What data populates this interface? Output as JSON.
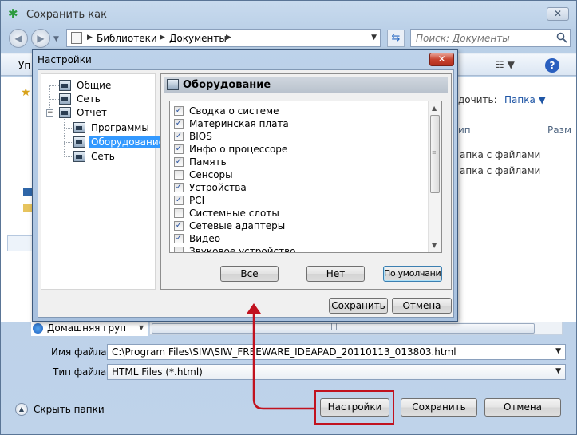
{
  "main": {
    "title": "Сохранить как",
    "close_glyph": "✕",
    "breadcrumbs": [
      "Библиотеки",
      "Документы"
    ],
    "search_placeholder": "Поиск: Документы",
    "toolbar_left": "Уп",
    "arrange_label": "дочить:",
    "arrange_value": "Папка",
    "columns": [
      "Тип",
      "Разм"
    ],
    "columns_visible": [
      "ип",
      "Разм"
    ],
    "file_rows": [
      "апка с файлами",
      "апка с файлами"
    ],
    "nav_home_group": "Домашняя груп",
    "filename_label": "Имя файла:",
    "filename_value": "C:\\Program Files\\SIW\\SIW_FREEWARE_IDEAPAD_20110113_013803.html",
    "filetype_label": "Тип файла:",
    "filetype_value": "HTML Files (*.html)",
    "hide_folders_label": "Скрыть папки",
    "buttons": {
      "settings": "Настройки",
      "save": "Сохранить",
      "cancel": "Отмена"
    }
  },
  "settings_dialog": {
    "title": "Настройки",
    "close_glyph": "✕",
    "tree": [
      {
        "label": "Общие"
      },
      {
        "label": "Сеть"
      },
      {
        "label": "Отчет"
      },
      {
        "label": "Программы"
      },
      {
        "label": "Оборудование",
        "selected": true
      },
      {
        "label": "Сеть"
      }
    ],
    "panel_title": "Оборудование",
    "checklist": [
      {
        "label": "Сводка о системе",
        "checked": true
      },
      {
        "label": "Материнская плата",
        "checked": true
      },
      {
        "label": "BIOS",
        "checked": true
      },
      {
        "label": "Инфо о процессоре",
        "checked": true
      },
      {
        "label": "Память",
        "checked": true
      },
      {
        "label": "Сенсоры",
        "checked": false
      },
      {
        "label": "Устройства",
        "checked": true
      },
      {
        "label": "PCI",
        "checked": true
      },
      {
        "label": "Системные слоты",
        "checked": false
      },
      {
        "label": "Сетевые адаптеры",
        "checked": true
      },
      {
        "label": "Видео",
        "checked": true
      },
      {
        "label": "Звуковое устройство",
        "checked": false
      }
    ],
    "buttons": {
      "all": "Все",
      "none": "Нет",
      "default": "По умолчанию",
      "save": "Сохранить",
      "cancel": "Отмена"
    }
  },
  "colors": {
    "annotation": "#c1121f",
    "selection": "#3399ff",
    "link": "#1e55a5"
  }
}
